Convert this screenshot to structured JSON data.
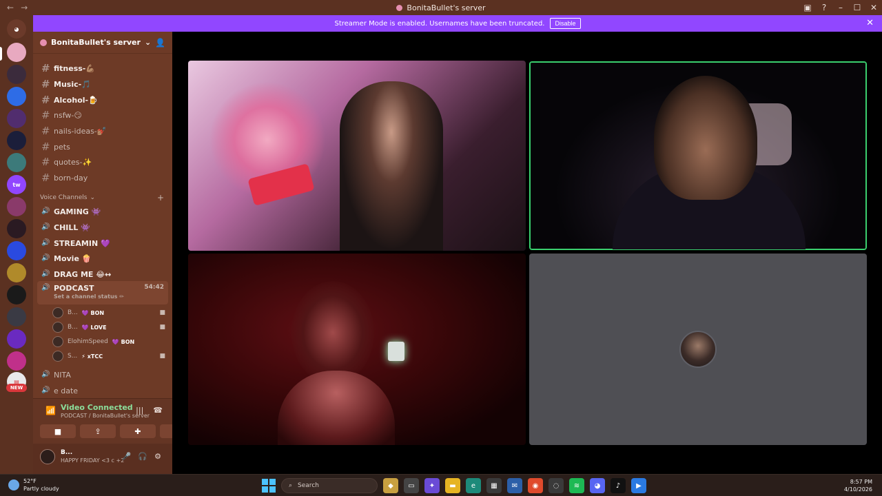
{
  "window": {
    "title": "BonitaBullet's server",
    "back_icon": "arrow-left-icon",
    "forward_icon": "arrow-right-icon"
  },
  "banner": {
    "message": "Streamer Mode is enabled. Usernames have been truncated.",
    "disable_label": "Disable",
    "color": "#9147ff"
  },
  "server": {
    "name": "BonitaBullet's server",
    "text_channels": [
      {
        "label": "fitness-💪🏽"
      },
      {
        "label": "Music-🎵"
      },
      {
        "label": "Alcohol-🍺"
      },
      {
        "label": "nsfw-😏"
      },
      {
        "label": "nails-ideas-💅🏽"
      },
      {
        "label": "pets"
      },
      {
        "label": "quotes-✨"
      },
      {
        "label": "born-day"
      }
    ],
    "voice_category": "Voice Channels",
    "voice_channels": [
      {
        "label": "GAMING 👾"
      },
      {
        "label": "CHILL 👾"
      },
      {
        "label": "STREAMIN 💜"
      },
      {
        "label": "Movie 🍿"
      },
      {
        "label": "DRAG ME 😂↔"
      }
    ],
    "active_channel": {
      "label": "PODCAST",
      "timer": "54:42",
      "status": "Set a channel status ✏"
    },
    "voice_users": [
      {
        "name": "B...",
        "tag": "💜 BON"
      },
      {
        "name": "B...",
        "tag": "💜 LOVE"
      },
      {
        "name": "ElohimSpeed",
        "tag": "💜 BON"
      },
      {
        "name": "S...",
        "tag": "⚡ xTCC"
      }
    ],
    "more_channels": [
      {
        "label": "NITA"
      },
      {
        "label": "e date"
      }
    ]
  },
  "voice_panel": {
    "status": "Video Connected",
    "location": "PODCAST / BonitaBullet's server"
  },
  "user": {
    "name": "B...",
    "status": "HAPPY FRIDAY <3 c +2"
  },
  "new_badge": "NEW",
  "taskbar": {
    "temperature": "52°F",
    "weather": "Partly cloudy",
    "search_placeholder": "Search",
    "time": "8:57 PM",
    "date": "4/10/2026"
  },
  "colors": {
    "sidebar": "#6d3a26",
    "rail": "#5b3121",
    "speaking_border": "#3bd16f",
    "connected_green": "#8bde9b"
  }
}
